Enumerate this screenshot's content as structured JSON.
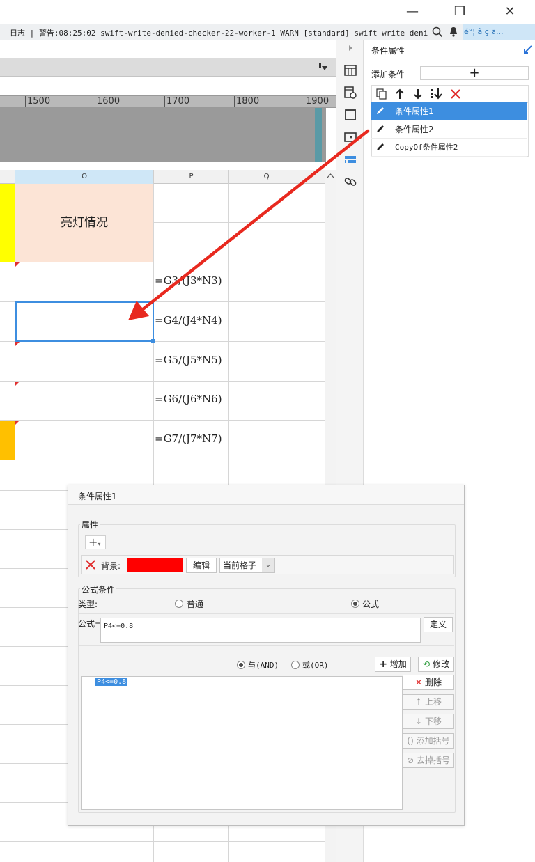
{
  "window": {
    "minimize_icon": "—",
    "restore_icon": "❐",
    "close_icon": "✕"
  },
  "logbar": {
    "text": "日志 | 警告:08:25:02 swift-write-denied-checker-22-worker-1 WARN [standard] swift write denied ho...",
    "tray": "é°¦ â   ç   ã..."
  },
  "ruler": {
    "ticks": [
      "1500",
      "1600",
      "1700",
      "1800",
      "1900"
    ]
  },
  "columns": [
    "O",
    "P",
    "Q"
  ],
  "sheet": {
    "header_cell": "亮灯情况",
    "formulas": [
      "=G3/(J3*N3)",
      "=G4/(J4*N4)",
      "=G5/(J5*N5)",
      "=G6/(J6*N6)",
      "=G7/(J7*N7)"
    ]
  },
  "panel": {
    "title": "条件属性",
    "add_condition_label": "添加条件",
    "add_button": "+",
    "items": [
      {
        "label": "条件属性1",
        "selected": true
      },
      {
        "label": "条件属性2",
        "selected": false
      },
      {
        "label": "CopyOf条件属性2",
        "selected": false
      }
    ]
  },
  "dialog": {
    "title": "条件属性1",
    "attr_legend": "属性",
    "add_attr": "+",
    "bg_label": "背景:",
    "bg_color": "#ff0000",
    "edit_button": "编辑",
    "scope_value": "当前格子",
    "formula_legend": "公式条件",
    "type_label": "类型:",
    "type_normal": "普通",
    "type_formula": "公式",
    "formula_label": "公式=",
    "formula_value": "P4<=0.8",
    "define_button": "定义",
    "and_label": "与(AND)",
    "or_label": "或(OR)",
    "add_button": "增加",
    "modify_button": "修改",
    "list_item": "P4<=0.8",
    "delete_button": "删除",
    "up_button": "上移",
    "down_button": "下移",
    "add_bracket_button": "添加括号",
    "remove_bracket_button": "去掉括号"
  },
  "colors": {
    "selection": "#3d8ee0",
    "yellow": "#ffff00",
    "orange": "#ffc000",
    "header_fill": "#fce4d6",
    "arrow": "#e8291f"
  }
}
